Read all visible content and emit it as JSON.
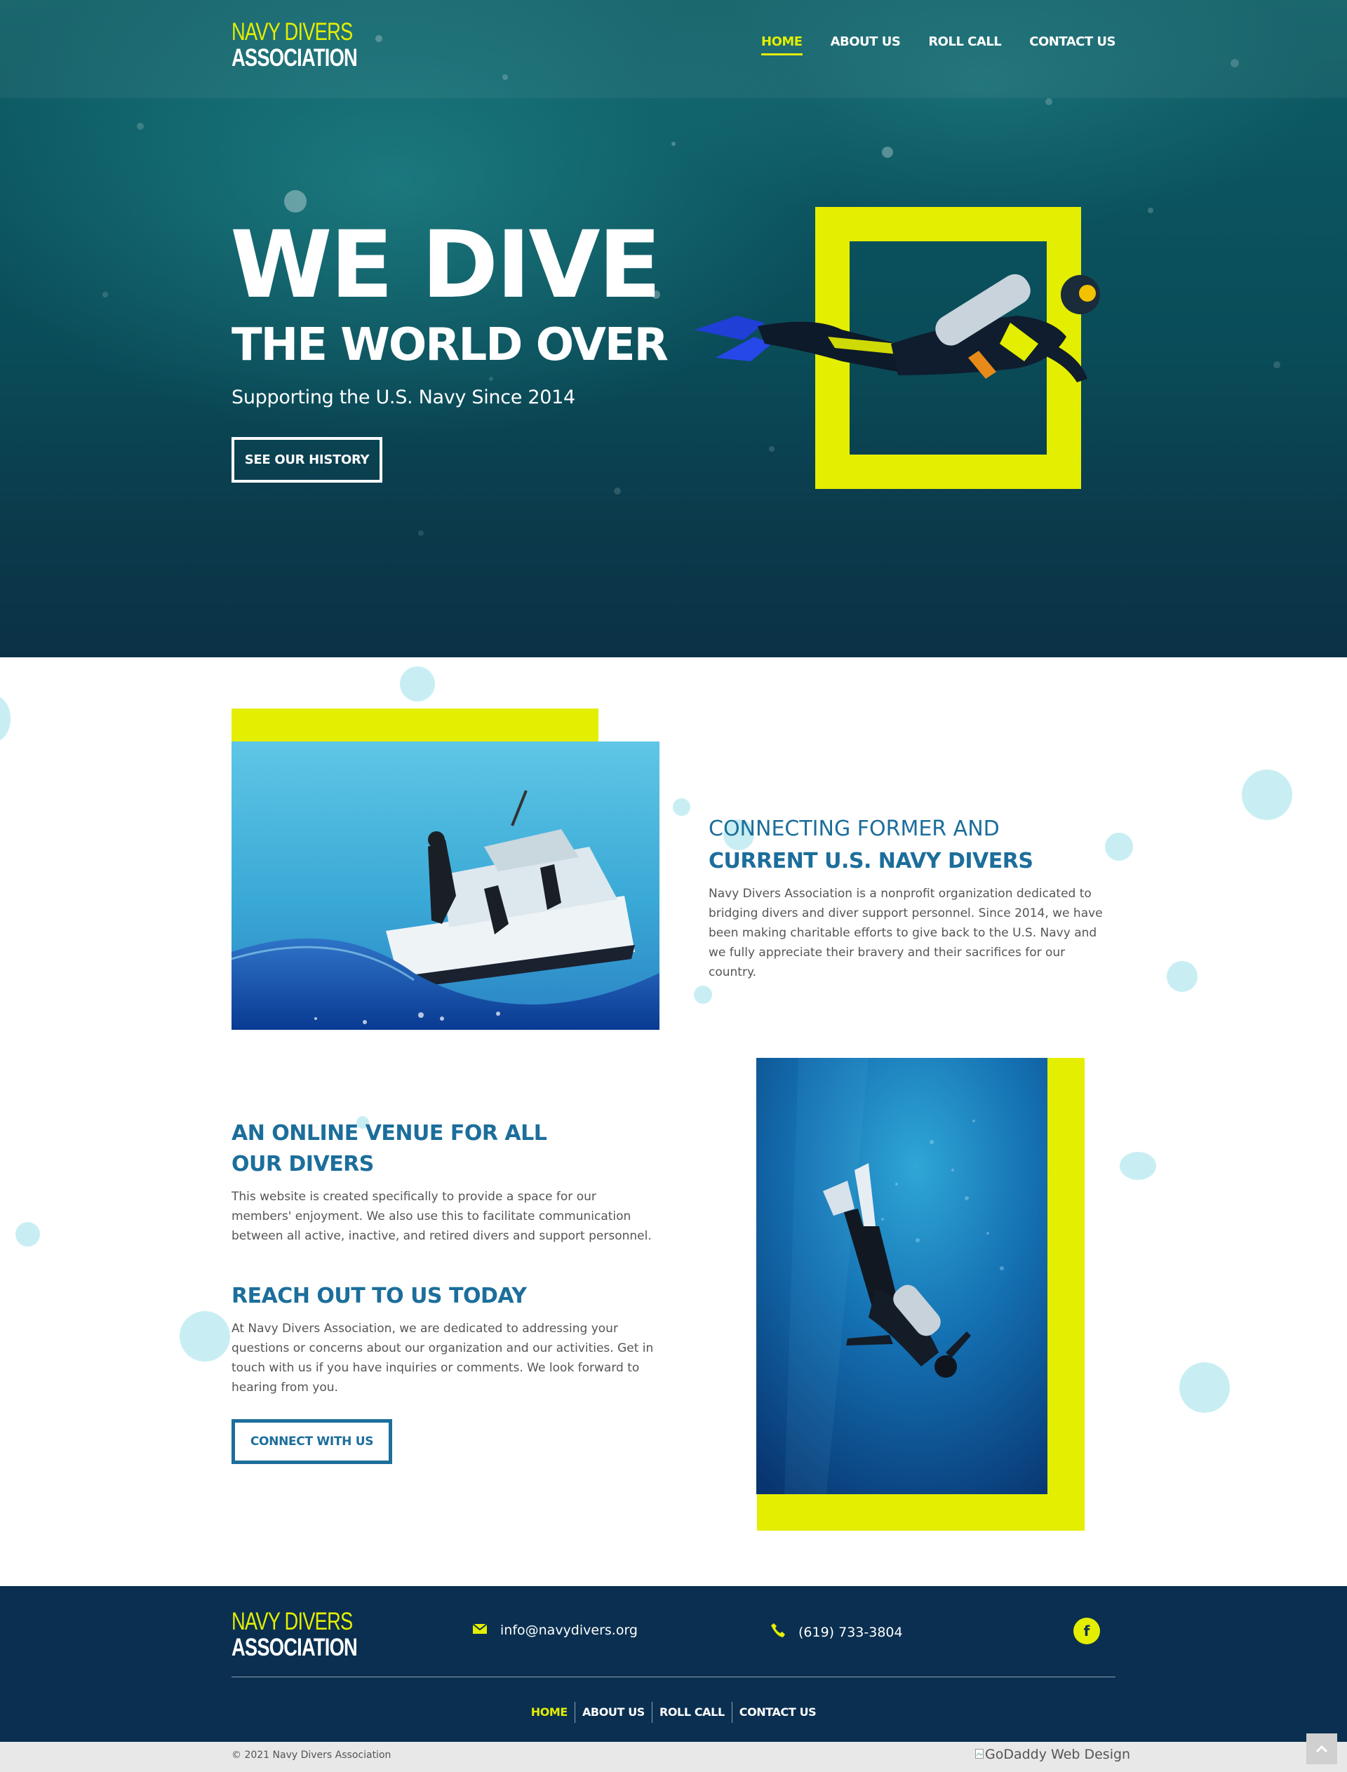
{
  "brand": {
    "line1": "NAVY DIVERS",
    "line2": "ASSOCIATION"
  },
  "nav": [
    {
      "label": "HOME",
      "active": true
    },
    {
      "label": "ABOUT US"
    },
    {
      "label": "ROLL CALL"
    },
    {
      "label": "CONTACT US"
    }
  ],
  "hero": {
    "headline": "WE DIVE",
    "headline2": "THE WORLD OVER",
    "subtitle": "Supporting the U.S. Navy Since 2014",
    "button": "SEE OUR HISTORY"
  },
  "section1": {
    "title_light": "CONNECTING FORMER AND",
    "title_bold": "CURRENT U.S. NAVY DIVERS",
    "body": "Navy Divers Association is a nonprofit organization dedicated to bridging divers and diver support personnel. Since 2014, we have been making charitable efforts to give back to the U.S. Navy and we fully appreciate their bravery and their sacrifices for our country."
  },
  "section2": {
    "title_line1": "AN ONLINE VENUE FOR ALL",
    "title_line2": "OUR DIVERS",
    "body": "This website is created specifically to provide a space for our members' enjoyment. We also use this to facilitate communication between all active, inactive, and retired divers and support personnel."
  },
  "section3": {
    "title": "REACH OUT TO US TODAY",
    "body": "At Navy Divers Association, we are dedicated to addressing your questions or concerns about our organization and our activities. Get in touch with us if you have inquiries or comments. We look forward to hearing from you.",
    "button": "CONNECT WITH US"
  },
  "footer": {
    "email": "info@navydivers.org",
    "phone": "(619) 733-3804",
    "facebook_glyph": "f",
    "nav": [
      {
        "label": "HOME",
        "active": true
      },
      {
        "label": "ABOUT US"
      },
      {
        "label": "ROLL CALL"
      },
      {
        "label": "CONTACT US"
      }
    ],
    "copyright": "© 2021 Navy Divers Association",
    "credit": "GoDaddy Web Design"
  },
  "colors": {
    "accent_yellow": "#e4ee00",
    "brand_blue": "#1c6e9b",
    "footer_navy": "#0a2f50",
    "bubble": "#c8eef3"
  },
  "icons": [
    "envelope-icon",
    "phone-icon",
    "facebook-icon",
    "chevron-up-icon",
    "broken-image-icon"
  ]
}
